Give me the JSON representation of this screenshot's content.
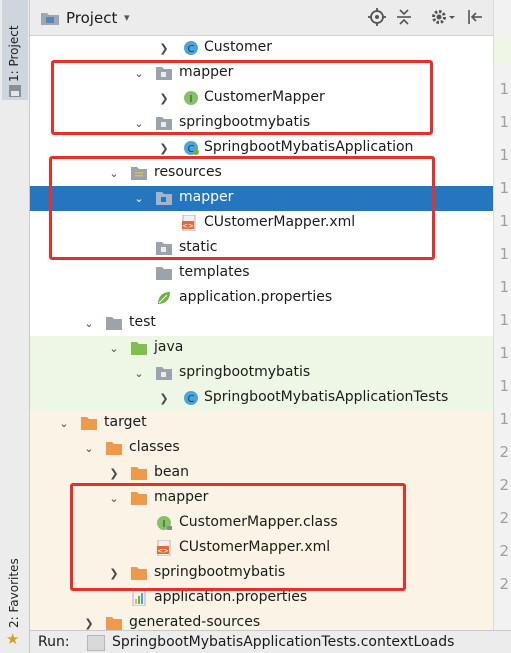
{
  "sidebar": {
    "project_tab": "1: Project",
    "favorites_tab": "2: Favorites"
  },
  "header": {
    "title": "Project",
    "caret": "▾"
  },
  "gutter": {
    "numbers": [
      "1",
      "1",
      "1",
      "1",
      "1",
      "1",
      "1",
      "1",
      "1",
      "1",
      "1",
      "2",
      "2",
      "2",
      "2",
      "2"
    ]
  },
  "tree": {
    "rows": [
      {
        "label": "Customer",
        "icon": "class-icon"
      },
      {
        "label": "mapper",
        "icon": "package-icon"
      },
      {
        "label": "CustomerMapper",
        "icon": "interface-icon"
      },
      {
        "label": "springbootmybatis",
        "icon": "package-icon"
      },
      {
        "label": "SpringbootMybatisApplication",
        "icon": "spring-class-icon"
      },
      {
        "label": "resources",
        "icon": "resources-folder-icon"
      },
      {
        "label": "mapper",
        "icon": "package-icon"
      },
      {
        "label": "CUstomerMapper.xml",
        "icon": "xml-icon"
      },
      {
        "label": "static",
        "icon": "package-icon"
      },
      {
        "label": "templates",
        "icon": "folder-icon"
      },
      {
        "label": "application.properties",
        "icon": "properties-icon"
      },
      {
        "label": "test",
        "icon": "folder-icon"
      },
      {
        "label": "java",
        "icon": "test-folder-icon"
      },
      {
        "label": "springbootmybatis",
        "icon": "package-icon"
      },
      {
        "label": "SpringbootMybatisApplicationTests",
        "icon": "class-icon"
      },
      {
        "label": "target",
        "icon": "orange-folder-icon"
      },
      {
        "label": "classes",
        "icon": "orange-folder-icon"
      },
      {
        "label": "bean",
        "icon": "orange-folder-icon"
      },
      {
        "label": "mapper",
        "icon": "orange-folder-icon"
      },
      {
        "label": "CustomerMapper.class",
        "icon": "class-file-icon"
      },
      {
        "label": "CUstomerMapper.xml",
        "icon": "xml-icon"
      },
      {
        "label": "springbootmybatis",
        "icon": "orange-folder-icon"
      },
      {
        "label": "application.properties",
        "icon": "properties-bar-icon"
      },
      {
        "label": "generated-sources",
        "icon": "orange-folder-icon"
      }
    ]
  },
  "runbar": {
    "label": "Run:",
    "tab": "SpringbootMybatisApplicationTests.contextLoads"
  },
  "colors": {
    "selection": "#2675bf",
    "annotation": "#e8302b",
    "test_bg": "#eef6e6",
    "target_bg": "#fbf3e6"
  }
}
